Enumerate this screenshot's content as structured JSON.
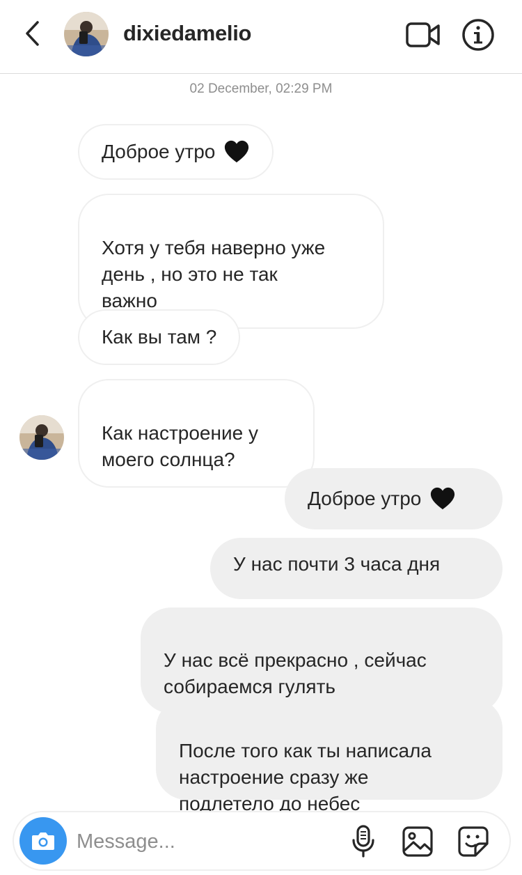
{
  "header": {
    "username": "dixiedamelio",
    "back_icon": "chevron-left-icon",
    "video_icon": "video-camera-icon",
    "info_icon": "info-icon"
  },
  "timestamp": "02 December, 02:29 PM",
  "messages": [
    {
      "sender": "them",
      "text": "Доброе утро",
      "emoji": "black-heart"
    },
    {
      "sender": "them",
      "text": "Хотя у тебя наверно уже\nдень , но это не так\nважно"
    },
    {
      "sender": "them",
      "text": "Как вы там ?"
    },
    {
      "sender": "them",
      "text": "Как настроение у\nмоего солнца?"
    },
    {
      "sender": "me",
      "text": "Доброе утро",
      "emoji": "black-heart"
    },
    {
      "sender": "me",
      "text": "У нас почти 3 часа дня"
    },
    {
      "sender": "me",
      "text": "У нас всё прекрасно , сейчас\nсобираемся гулять"
    },
    {
      "sender": "me",
      "text": "После того как ты написала\nнастроение сразу же\nподлетело до небес"
    }
  ],
  "composer": {
    "placeholder": "Message...",
    "camera_icon": "camera-icon",
    "mic_icon": "microphone-icon",
    "gallery_icon": "gallery-icon",
    "sticker_icon": "sticker-icon"
  },
  "colors": {
    "accent": "#3897f0",
    "outgoing_bubble": "#efefef",
    "incoming_border": "#efefef",
    "text": "#262626",
    "muted": "#8e8e8e"
  }
}
